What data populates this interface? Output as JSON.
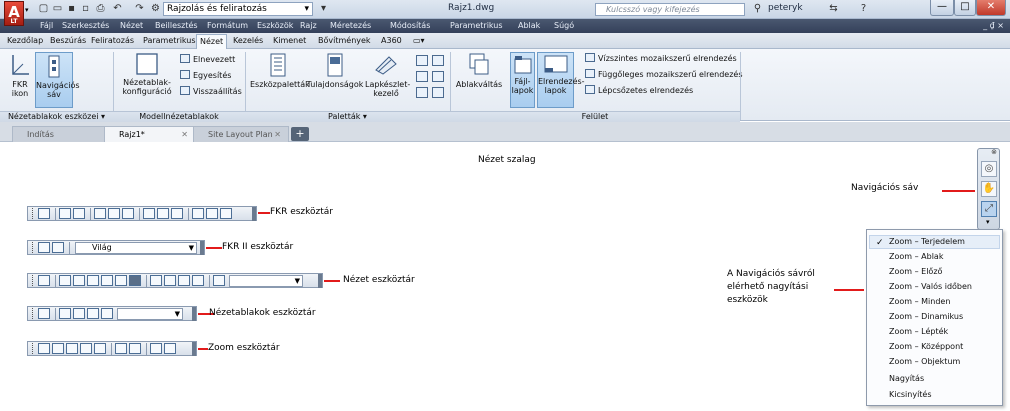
{
  "app": {
    "logo_letter": "A",
    "logo_sub": "LT"
  },
  "quick_access": {
    "workspace": "Rajzolás és feliratozás"
  },
  "title": {
    "document": "Rajz1.dwg",
    "search_placeholder": "Kulcsszó vagy kifejezés",
    "user": "peteryk"
  },
  "window_controls": {
    "minimize": "—",
    "maximize": "□",
    "close": "✕"
  },
  "menu": {
    "items": [
      "Fájl",
      "Szerkesztés",
      "Nézet",
      "Beillesztés",
      "Formátum",
      "Eszközök",
      "Rajz",
      "Méretezés",
      "Módosítás",
      "Parametrikus",
      "Ablak",
      "Súgó"
    ],
    "right": "_ ₫ ×"
  },
  "ribbon_tabs": [
    "Kezdőlap",
    "Beszúrás",
    "Feliratozás",
    "Parametrikus",
    "Nézet",
    "Kezelés",
    "Kimenet",
    "Bővítmények",
    "A360"
  ],
  "ribbon_tab_active": 4,
  "ribbon": {
    "fkr_ikon": "FKR ikon",
    "nav_sav": "Navigációs sáv",
    "nezetablak_konf": "Nézetablak-konfiguráció",
    "elnevezett": "Elnevezett",
    "egyesites": "Egyesítés",
    "visszaallitas": "Visszaállítás",
    "eszkozpaletta": "Eszközpaletták",
    "tulajdonsagok": "Tulajdonságok",
    "lapkeszlet": "Lapkészlet-kezelő",
    "ablakvaltas": "Ablakváltás",
    "fajl_lapok": "Fájl-lapok",
    "elrendezes_lapok": "Elrendezés-lapok",
    "vizszintes": "Vízszintes mozaikszerű elrendezés",
    "fuggoleges": "Függőleges mozaikszerű elrendezés",
    "lepcsozetes": "Lépcsőzetes elrendezés",
    "panels": [
      "Nézetablakok eszközei ▾",
      "Modellnézetablakok",
      "Paletták ▾",
      "Felület"
    ]
  },
  "doc_tabs": {
    "tabs": [
      "Indítás",
      "Rajz1*",
      "Site Layout Plan"
    ],
    "active": 1,
    "plus": "+"
  },
  "canvas": {
    "title": "Nézet szalag",
    "fkr_toolbar": "FKR eszköztár",
    "fkr2_toolbar": "FKR II eszköztár",
    "fkr2_combo": "Világ",
    "nezet_toolbar": "Nézet eszköztár",
    "nezetablakok_toolbar": "Nézetablakok eszköztár",
    "zoom_toolbar": "Zoom eszköztár",
    "nav_callout": "Navigációs sáv",
    "zoom_callout_1": "A Navigációs sávról",
    "zoom_callout_2": "elérhető nagyítási",
    "zoom_callout_3": "eszközök"
  },
  "zoom_menu": {
    "items": [
      "Zoom – Terjedelem",
      "Zoom – Ablak",
      "Zoom – Előző",
      "Zoom – Valós időben",
      "Zoom – Minden",
      "Zoom – Dinamikus",
      "Zoom – Lépték",
      "Zoom – Középpont",
      "Zoom – Objektum",
      "Nagyítás",
      "Kicsinyítés"
    ],
    "checked": 0,
    "check_glyph": "✓"
  }
}
